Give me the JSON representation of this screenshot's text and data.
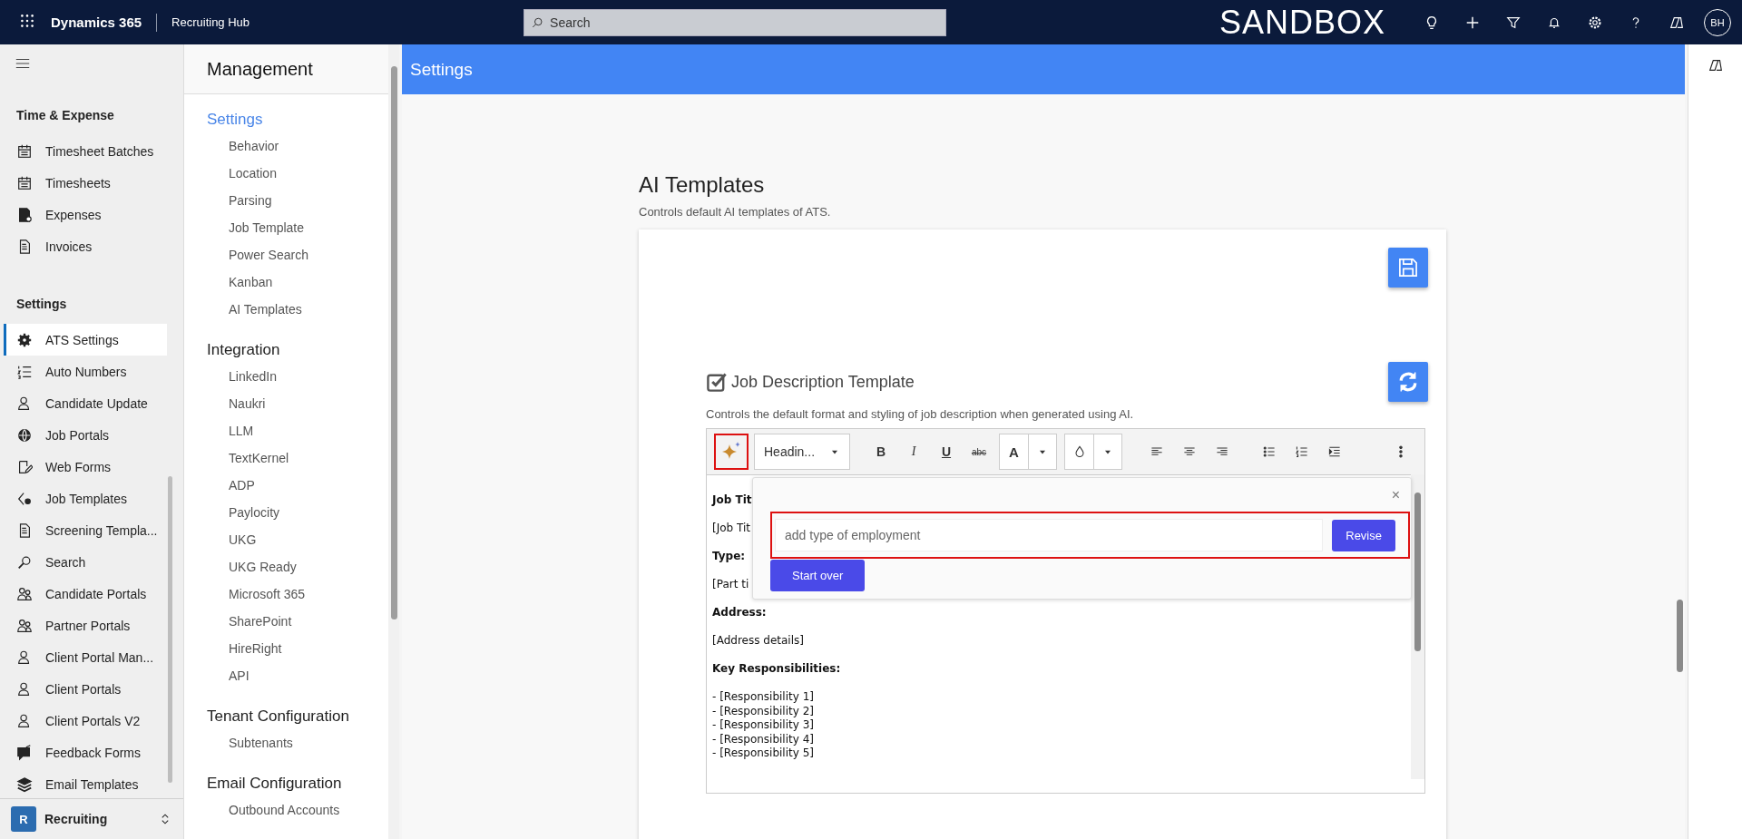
{
  "top_bar": {
    "app_name": "Dynamics 365",
    "area_name": "Recruiting Hub",
    "search": {
      "placeholder": "Search"
    },
    "environment": "SANDBOX",
    "avatar": "BH"
  },
  "sitemap": {
    "groups": [
      {
        "title": "Time & Expense",
        "items": [
          {
            "label": "Timesheet Batches",
            "selected": false
          },
          {
            "label": "Timesheets",
            "selected": false
          },
          {
            "label": "Expenses",
            "selected": false
          },
          {
            "label": "Invoices",
            "selected": false
          }
        ]
      },
      {
        "title": "Settings",
        "items": [
          {
            "label": "ATS Settings",
            "selected": true
          },
          {
            "label": "Auto Numbers",
            "selected": false
          },
          {
            "label": "Candidate Update",
            "selected": false
          },
          {
            "label": "Job Portals",
            "selected": false
          },
          {
            "label": "Web Forms",
            "selected": false
          },
          {
            "label": "Job Templates",
            "selected": false
          },
          {
            "label": "Screening Templa...",
            "selected": false
          },
          {
            "label": "Search",
            "selected": false
          },
          {
            "label": "Candidate Portals",
            "selected": false
          },
          {
            "label": "Partner Portals",
            "selected": false
          },
          {
            "label": "Client Portal Man...",
            "selected": false
          },
          {
            "label": "Client Portals",
            "selected": false
          },
          {
            "label": "Client Portals V2",
            "selected": false
          },
          {
            "label": "Feedback Forms",
            "selected": false
          },
          {
            "label": "Email Templates",
            "selected": false
          }
        ]
      }
    ],
    "area_switcher": {
      "badge": "R",
      "label": "Recruiting"
    }
  },
  "management": {
    "title": "Management",
    "sections": [
      {
        "title": "Settings",
        "selected": true,
        "items": [
          "Behavior",
          "Location",
          "Parsing",
          "Job Template",
          "Power Search",
          "Kanban",
          "AI Templates"
        ]
      },
      {
        "title": "Integration",
        "selected": false,
        "items": [
          "LinkedIn",
          "Naukri",
          "LLM",
          "TextKernel",
          "ADP",
          "Paylocity",
          "UKG",
          "UKG Ready",
          "Microsoft 365",
          "SharePoint",
          "HireRight",
          "API"
        ]
      },
      {
        "title": "Tenant Configuration",
        "selected": false,
        "items": [
          "Subtenants"
        ]
      },
      {
        "title": "Email Configuration",
        "selected": false,
        "items": [
          "Outbound Accounts"
        ]
      }
    ]
  },
  "page_header": {
    "title": "Settings"
  },
  "content": {
    "title": "AI Templates",
    "subtitle": "Controls default AI templates of ATS.",
    "template": {
      "title": "Job Description Template",
      "checked": true,
      "description": "Controls the default format and styling of job description when generated using AI.",
      "ai_button": {
        "highlighted": true
      },
      "toolbar": [
        {
          "kind": "dropdown",
          "label": "Headin..."
        },
        {
          "kind": "bold",
          "label": "B"
        },
        {
          "kind": "italic",
          "label": "I"
        },
        {
          "kind": "underline",
          "label": "U"
        },
        {
          "kind": "strike",
          "label": "abc"
        },
        {
          "kind": "font-color",
          "label": "A"
        },
        {
          "kind": "fill-color"
        },
        {
          "kind": "align-left"
        },
        {
          "kind": "align-center"
        },
        {
          "kind": "align-right"
        },
        {
          "kind": "bullets"
        },
        {
          "kind": "numbering"
        },
        {
          "kind": "indent"
        },
        {
          "kind": "more"
        }
      ],
      "body": [
        {
          "kind": "heading",
          "text": "Job Tit"
        },
        {
          "kind": "para",
          "text": "[Job Tit"
        },
        {
          "kind": "heading",
          "text": "Type:"
        },
        {
          "kind": "para",
          "text": "[Part ti"
        },
        {
          "kind": "heading",
          "text": "Address:"
        },
        {
          "kind": "para",
          "text": "[Address details]"
        },
        {
          "kind": "heading",
          "text": "Key Responsibilities:"
        },
        {
          "kind": "line",
          "text": "- [Responsibility 1]"
        },
        {
          "kind": "line",
          "text": "- [Responsibility 2]"
        },
        {
          "kind": "line",
          "text": "- [Responsibility 3]"
        },
        {
          "kind": "line",
          "text": "- [Responsibility 4]"
        },
        {
          "kind": "line",
          "text": "- [Responsibility 5]"
        }
      ],
      "ai_prompt": {
        "close": "×",
        "placeholder": "add type of employment",
        "highlighted": true,
        "revise": "Revise",
        "start_over": "Start over"
      }
    }
  }
}
